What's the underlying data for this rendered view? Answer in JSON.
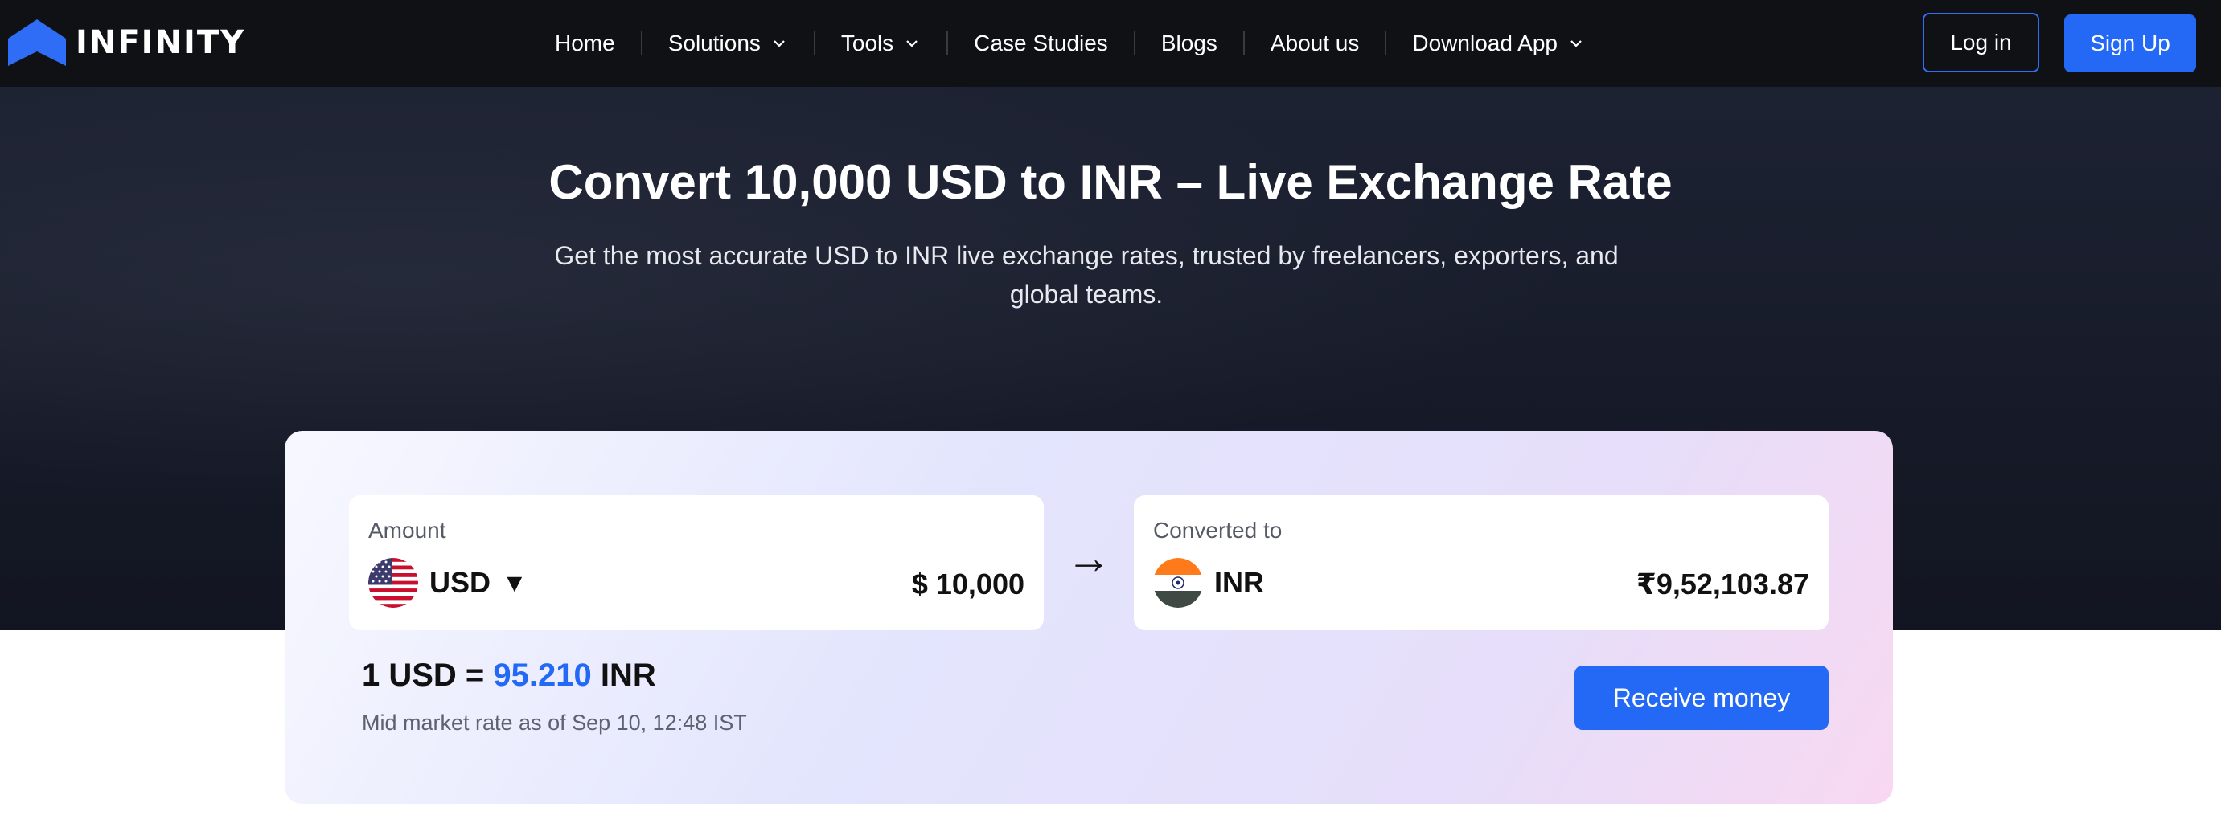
{
  "brand": {
    "name": "INFINITY",
    "icon": "logo-chevron-icon",
    "color": "#2f6df6"
  },
  "nav": {
    "items": [
      {
        "label": "Home",
        "has_dropdown": false
      },
      {
        "label": "Solutions",
        "has_dropdown": true
      },
      {
        "label": "Tools",
        "has_dropdown": true
      },
      {
        "label": "Case Studies",
        "has_dropdown": false
      },
      {
        "label": "Blogs",
        "has_dropdown": false
      },
      {
        "label": "About us",
        "has_dropdown": false
      },
      {
        "label": "Download App",
        "has_dropdown": true
      }
    ],
    "login_label": "Log in",
    "signup_label": "Sign Up"
  },
  "hero": {
    "title": "Convert 10,000 USD to INR – Live Exchange Rate",
    "subtitle_line1": "Get the most accurate USD to INR live exchange rates, trusted by freelancers, exporters, and",
    "subtitle_line2": "global teams."
  },
  "converter": {
    "from": {
      "label": "Amount",
      "currency": "USD",
      "caret": "▼",
      "amount": "$ 10,000",
      "flag": "us-flag-icon"
    },
    "arrow": "→",
    "to": {
      "label": "Converted to",
      "currency": "INR",
      "amount": "₹9,52,103.87",
      "flag": "india-flag-icon"
    },
    "rate_prefix": "1 USD =",
    "rate_value": "95.210",
    "rate_suffix": "INR",
    "rate_note": "Mid market rate as of Sep 10, 12:48 IST",
    "cta_label": "Receive money"
  },
  "colors": {
    "accent": "#2369f6",
    "nav_bg": "#101114",
    "hero_bg": "#1a1e2d"
  }
}
